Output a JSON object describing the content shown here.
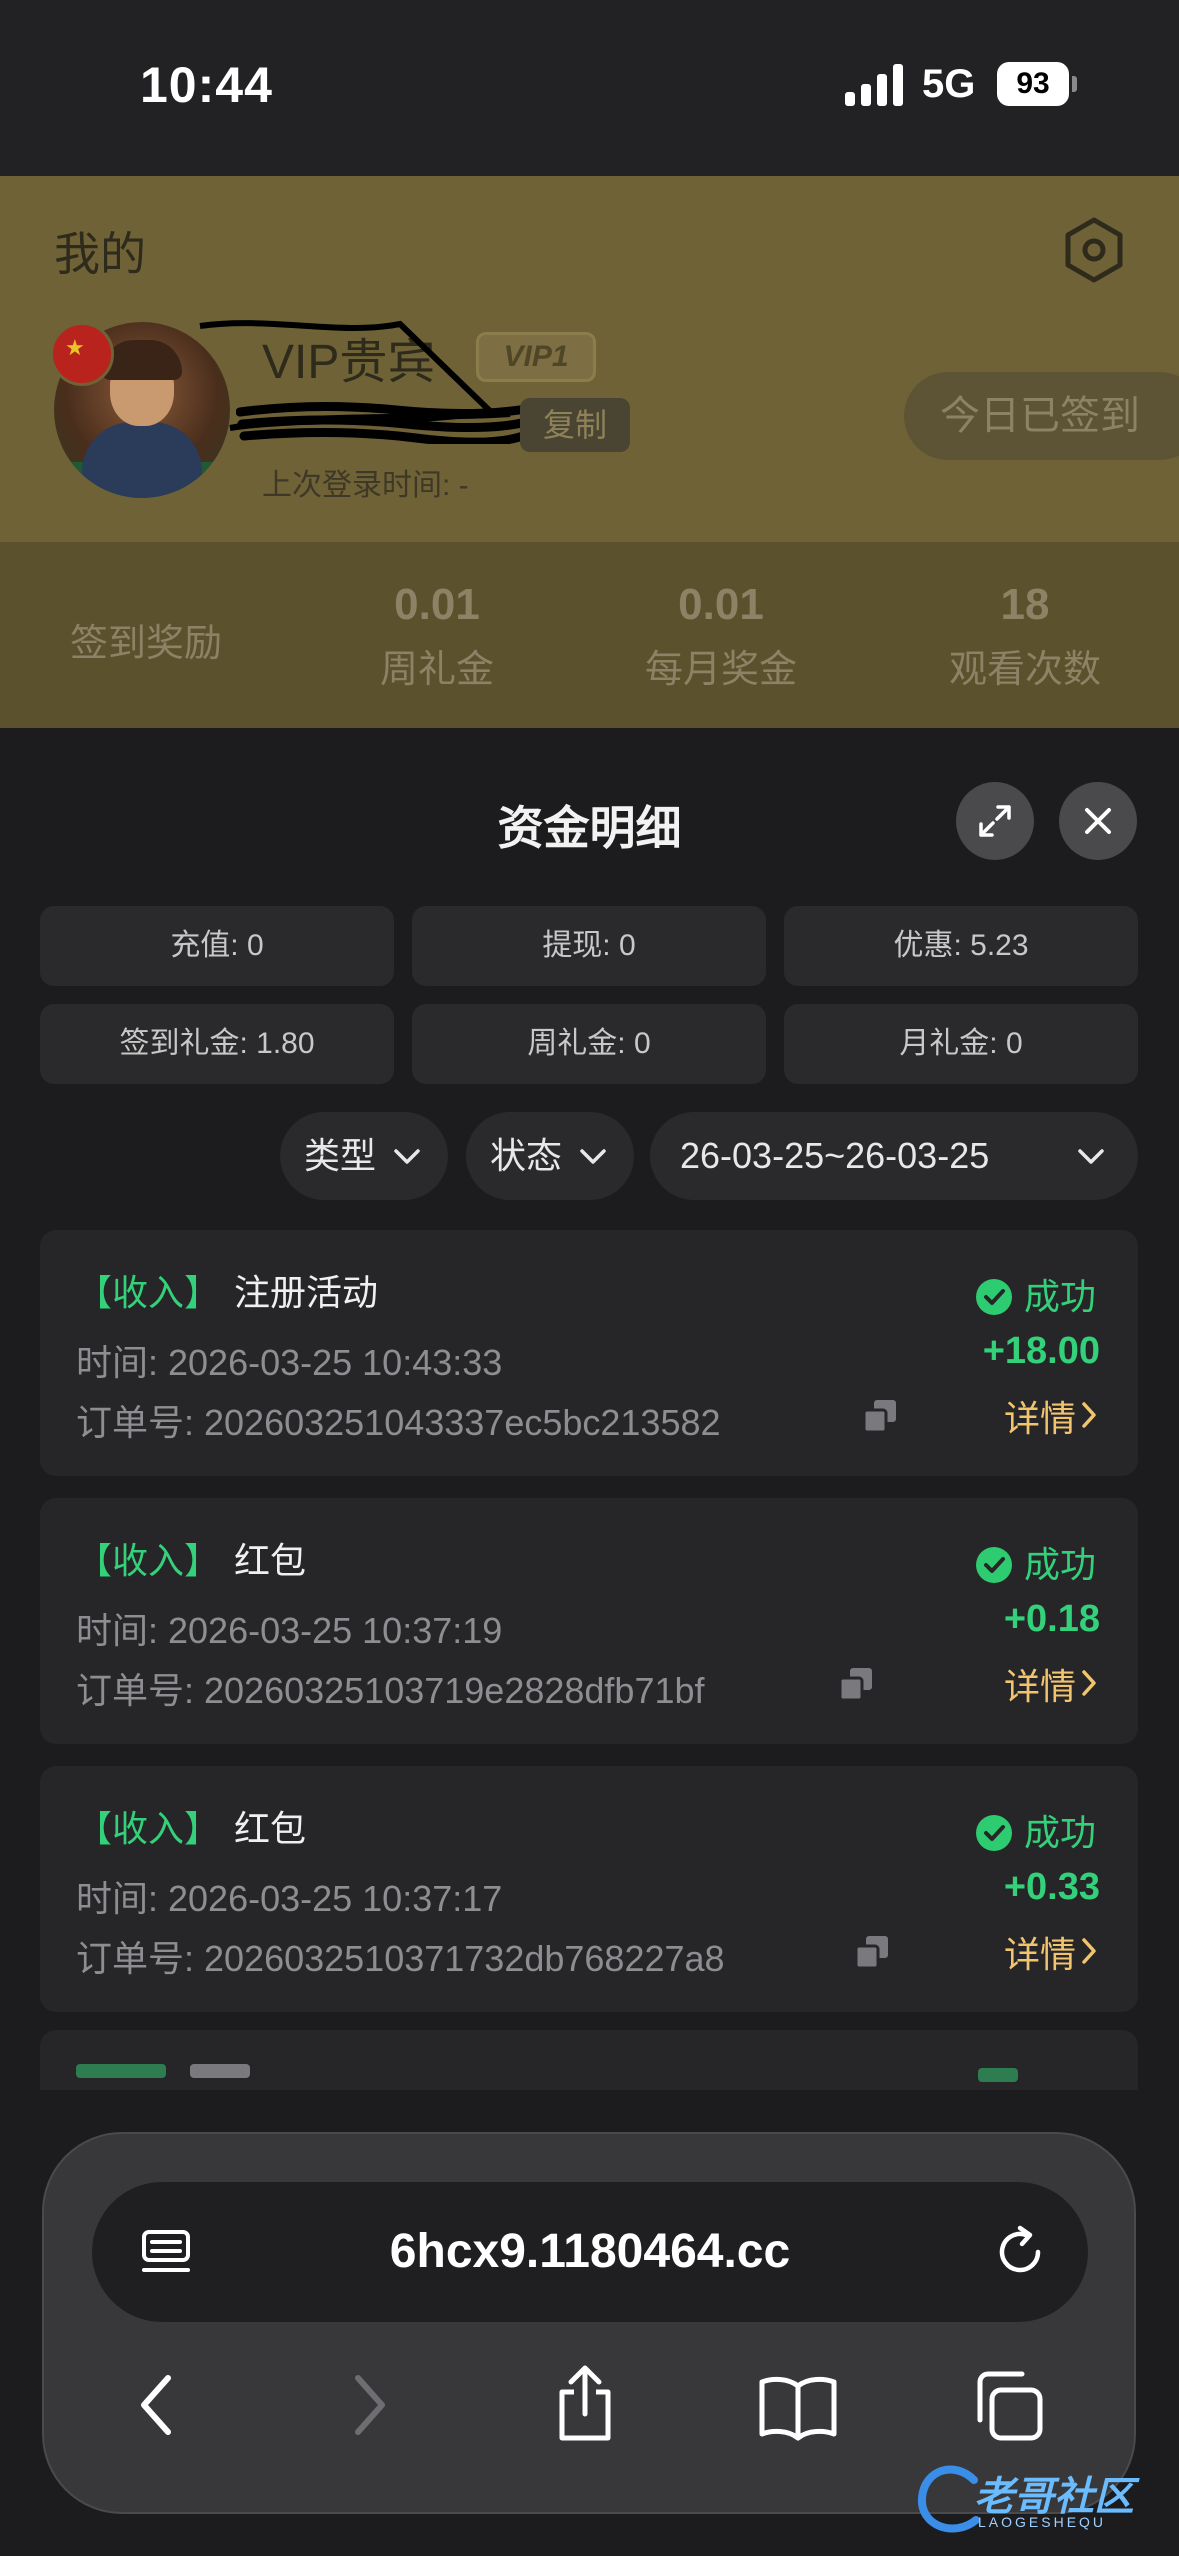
{
  "status_bar": {
    "time": "10:44",
    "network": "5G",
    "battery": "93"
  },
  "profile": {
    "title": "我的",
    "vip_name": "VIP贵宾",
    "vip_level": "VIP1",
    "copy_label": "复制",
    "last_login": "上次登录时间: -",
    "checkin_label": "今日已签到"
  },
  "stats": {
    "left_label": "签到奖励",
    "items": [
      {
        "value": "0.01",
        "label": "周礼金"
      },
      {
        "value": "0.01",
        "label": "每月奖金"
      },
      {
        "value": "18",
        "label": "观看次数"
      }
    ]
  },
  "sheet": {
    "title": "资金明细",
    "summary": [
      "充值: 0",
      "提现: 0",
      "优惠: 5.23",
      "签到礼金: 1.80",
      "周礼金: 0",
      "月礼金: 0"
    ],
    "filters": {
      "type": "类型",
      "status": "状态",
      "date_range": "26-03-25~26-03-25"
    },
    "records": [
      {
        "tag": "【收入】",
        "name": "注册活动",
        "time": "时间:  2026-03-25 10:43:33",
        "order": "订单号:  202603251043337ec5bc213582",
        "status": "成功",
        "amount": "+18.00",
        "detail": "详情"
      },
      {
        "tag": "【收入】",
        "name": "红包",
        "time": "时间:  2026-03-25 10:37:19",
        "order": "订单号:  20260325103719e2828dfb71bf",
        "status": "成功",
        "amount": "+0.18",
        "detail": "详情"
      },
      {
        "tag": "【收入】",
        "name": "红包",
        "time": "时间:  2026-03-25 10:37:17",
        "order": "订单号:  2026032510371732db768227a8",
        "status": "成功",
        "amount": "+0.33",
        "detail": "详情"
      }
    ]
  },
  "browser": {
    "url": "6hcx9.1180464.cc"
  },
  "watermark": {
    "text": "老哥社区",
    "sub": "LAOGESHEQU"
  }
}
